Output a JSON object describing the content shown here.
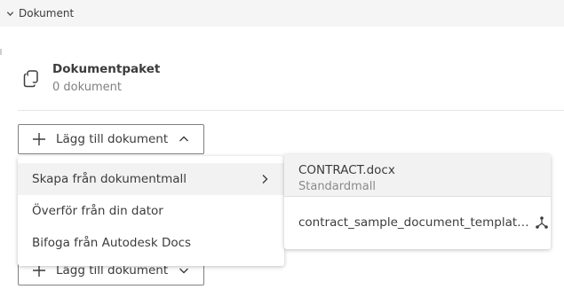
{
  "section": {
    "title": "Dokument",
    "toggle_icon": "chevron-down-icon"
  },
  "package": {
    "icon": "copy-documents-icon",
    "title": "Dokumentpaket",
    "subtitle": "0 dokument"
  },
  "add_button_top": {
    "label": "Lägg till dokument",
    "icon": "plus-icon",
    "caret": "chevron-up-icon"
  },
  "add_button_bottom": {
    "label": "Lägg till dokument",
    "icon": "plus-icon",
    "caret": "chevron-down-icon"
  },
  "menu": {
    "items": [
      {
        "label": "Skapa från dokumentmall",
        "has_submenu": true,
        "active": true
      },
      {
        "label": "Överför från din dator"
      },
      {
        "label": "Bifoga från Autodesk Docs"
      }
    ]
  },
  "submenu": {
    "items": [
      {
        "name": "CONTRACT.docx",
        "description": "Standardmall"
      },
      {
        "name": "contract_sample_document_template.docx",
        "icon": "hub-network-icon"
      }
    ]
  },
  "colors": {
    "header_bg": "#f5f5f5",
    "text": "#3c3c3c",
    "muted_text": "#808080",
    "hover_bg": "#f2f2f2",
    "border": "#808080"
  }
}
